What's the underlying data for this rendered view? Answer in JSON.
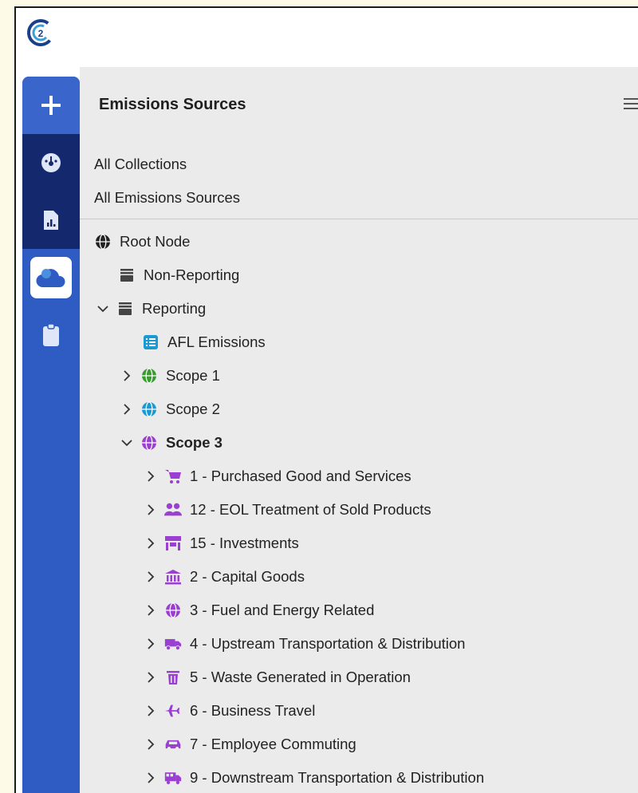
{
  "panel": {
    "title": "Emissions Sources"
  },
  "links": [
    "All Collections",
    "All Emissions Sources"
  ],
  "tree": {
    "root": "Root Node",
    "non_reporting": "Non-Reporting",
    "reporting": "Reporting",
    "afl": "AFL Emissions",
    "scope1": "Scope 1",
    "scope2": "Scope 2",
    "scope3": "Scope 3",
    "categories": [
      {
        "label": "1 - Purchased Good and Services",
        "icon": "cart-icon"
      },
      {
        "label": "12 - EOL Treatment of Sold Products",
        "icon": "users-icon"
      },
      {
        "label": "15 - Investments",
        "icon": "store-icon"
      },
      {
        "label": "2 - Capital Goods",
        "icon": "bank-icon"
      },
      {
        "label": "3 - Fuel and Energy Related",
        "icon": "globe-icon"
      },
      {
        "label": "4 - Upstream Transportation & Distribution",
        "icon": "truck-icon"
      },
      {
        "label": "5 - Waste Generated in Operation",
        "icon": "trash-icon"
      },
      {
        "label": "6 - Business Travel",
        "icon": "plane-icon"
      },
      {
        "label": "7 - Employee Commuting",
        "icon": "car-icon"
      },
      {
        "label": "9 - Downstream Transportation & Distribution",
        "icon": "shuttle-icon"
      }
    ]
  },
  "colors": {
    "accent_purple": "#9b3fd3",
    "rail_blue": "#2f5cc2",
    "rail_dark": "#14286d",
    "scope1_green": "#3a9b2f",
    "scope2_teal": "#1b9ad1"
  }
}
